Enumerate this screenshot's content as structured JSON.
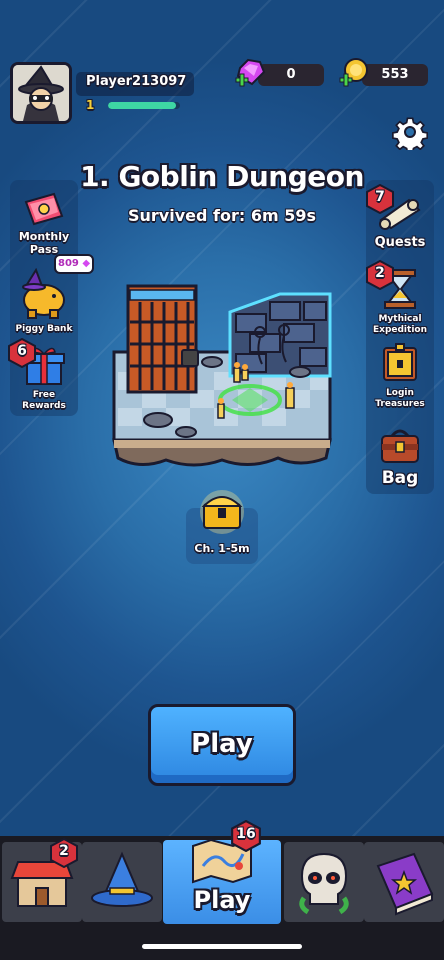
{
  "player": {
    "name": "Player213097",
    "level": "1",
    "xp_fraction": 0.95
  },
  "currency": {
    "gems": "0",
    "gold": "553"
  },
  "stage": {
    "title": "1. Goblin Dungeon",
    "survived": "Survived for: 6m 59s"
  },
  "left_menu": {
    "monthly_pass": {
      "label_line1": "Monthly",
      "label_line2": "Pass"
    },
    "piggy_bank": {
      "label": "Piggy Bank",
      "bubble": "809"
    },
    "free_rewards": {
      "label_line1": "Free",
      "label_line2": "Rewards",
      "badge": "6"
    }
  },
  "right_menu": {
    "quests": {
      "label": "Quests",
      "badge": "7"
    },
    "mythical_expedition": {
      "label_line1": "Mythical",
      "label_line2": "Expedition",
      "badge": "2"
    },
    "login_treasures": {
      "label_line1": "Login",
      "label_line2": "Treasures"
    },
    "bag": {
      "label": "Bag"
    }
  },
  "chest": {
    "label": "Ch. 1-5m"
  },
  "play_button": {
    "label": "Play"
  },
  "bottom_nav": {
    "shop": {
      "icon": "shop-icon",
      "badge": "2"
    },
    "hero": {
      "icon": "wizard-hat-icon"
    },
    "play": {
      "icon": "map-icon",
      "label": "Play",
      "badge": "16"
    },
    "enemies": {
      "icon": "skull-icon"
    },
    "spellbook": {
      "icon": "spellbook-icon"
    }
  },
  "colors": {
    "background": "#2a6ea8",
    "accent_blue": "#4fb2ff",
    "badge_red": "#d8323c",
    "xp_green": "#3ed6a4",
    "gold": "#f4c531"
  }
}
